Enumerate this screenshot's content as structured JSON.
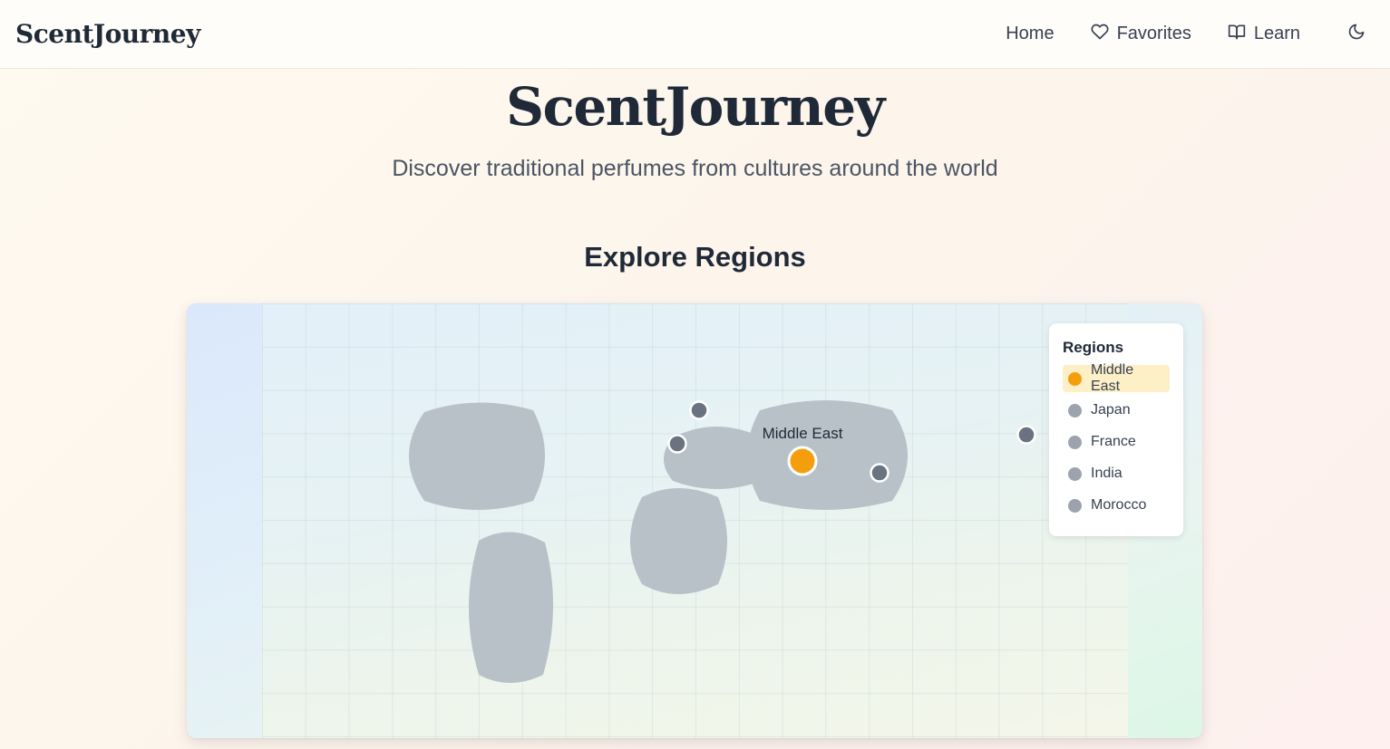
{
  "brand": "ScentJourney",
  "nav": {
    "items": [
      {
        "label": "Home",
        "icon": "none"
      },
      {
        "label": "Favorites",
        "icon": "heart-icon"
      },
      {
        "label": "Learn",
        "icon": "book-icon"
      }
    ],
    "theme_icon": "moon-icon"
  },
  "hero": {
    "title": "ScentJourney",
    "subtitle": "Discover traditional perfumes from cultures around the world"
  },
  "explore": {
    "title": "Explore Regions"
  },
  "map": {
    "active_label": "Middle East",
    "legend_title": "Regions",
    "regions": [
      {
        "name": "Middle East",
        "color": "#f59e0b",
        "active": true
      },
      {
        "name": "Japan",
        "color": "#9ca3af",
        "active": false
      },
      {
        "name": "France",
        "color": "#9ca3af",
        "active": false
      },
      {
        "name": "India",
        "color": "#9ca3af",
        "active": false
      },
      {
        "name": "Morocco",
        "color": "#9ca3af",
        "active": false
      }
    ],
    "marker_color": "#6b7280",
    "active_color": "#f59e0b"
  }
}
